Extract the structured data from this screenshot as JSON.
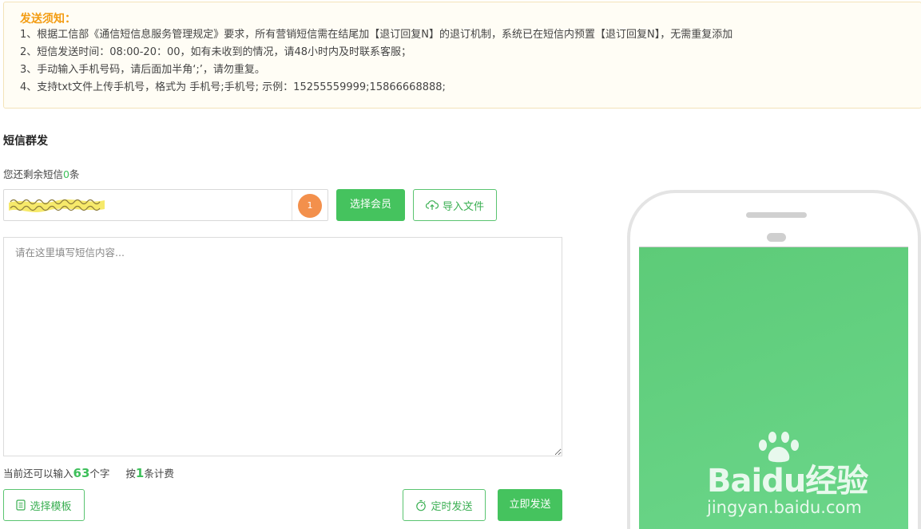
{
  "notice": {
    "title": "发送须知：",
    "lines": [
      "1、根据工信部《通信短信息服务管理规定》要求，所有营销短信需在结尾加【退订回复N】的退订机制，系统已在短信内预置【退订回复N】，无需重复添加",
      "2、短信发送时间：08:00-20：00，如有未收到的情况，请48小时内及时联系客服；",
      "3、手动输入手机号码，请后面加半角‘;’，请勿重复。",
      "4、支持txt文件上传手机号，格式为 手机号;手机号; 示例：15255559999;15866668888;"
    ]
  },
  "section": {
    "title": "短信群发",
    "remain_prefix": "您还剩余短信",
    "remain_count": "0",
    "remain_suffix": "条"
  },
  "recipients": {
    "count_badge": "1",
    "choose_member_label": "选择会员",
    "import_file_label": "导入文件"
  },
  "editor": {
    "placeholder": "请在这里填写短信内容..."
  },
  "counter": {
    "prefix": "当前还可以输入",
    "chars_left": "63",
    "chars_suffix": "个字",
    "bill_prefix": "按",
    "bill_count": "1",
    "bill_suffix": "条计费"
  },
  "actions": {
    "choose_template_label": "选择模板",
    "timed_send_label": "定时发送",
    "send_now_label": "立即发送"
  },
  "preview": {
    "watermark_brand": "Baidu经验",
    "watermark_url": "jingyan.baidu.com"
  },
  "colors": {
    "accent_green": "#45c35e",
    "notice_title": "#f39c12",
    "badge_orange": "#f3904c"
  }
}
